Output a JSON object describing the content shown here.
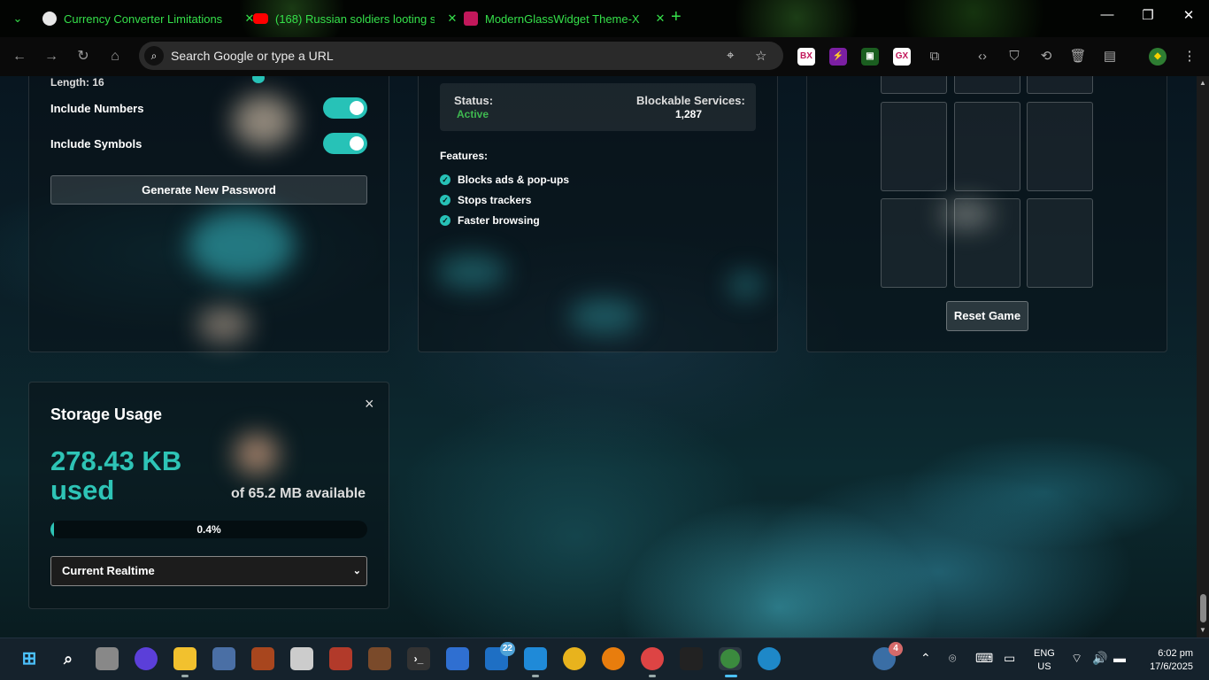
{
  "tabs": [
    {
      "title": "Currency Converter Limitations",
      "favicon": "chatgpt-icon"
    },
    {
      "title": "(168) Russian soldiers looting s",
      "favicon": "youtube-icon"
    },
    {
      "title": "ModernGlassWidget Theme-X",
      "favicon": "operagx-icon"
    }
  ],
  "toolbar": {
    "search_placeholder": "Search Google or type a URL",
    "extensions": [
      "BX",
      "⚡",
      "▣",
      "GX"
    ]
  },
  "password_panel": {
    "length_label": "Length: 16",
    "include_numbers_label": "Include Numbers",
    "include_numbers_on": true,
    "include_symbols_label": "Include Symbols",
    "include_symbols_on": true,
    "generate_button": "Generate New Password"
  },
  "adblock_panel": {
    "status_label": "Status:",
    "status_value": "Active",
    "blockable_label": "Blockable Services:",
    "blockable_value": "1,287",
    "features_title": "Features:",
    "features": [
      "Blocks ads & pop-ups",
      "Stops trackers",
      "Faster browsing"
    ]
  },
  "game_panel": {
    "reset_button": "Reset Game"
  },
  "storage_panel": {
    "title": "Storage Usage",
    "used_value": "278.43 KB",
    "used_suffix": "used",
    "available_text": "of 65.2 MB available",
    "progress_text": "0.4%",
    "progress_fraction": 0.004,
    "select_value": "Current Realtime",
    "close_glyph": "×"
  },
  "taskbar": {
    "mail_badge": "22",
    "weather_badge": "4",
    "lang_top": "ENG",
    "lang_bottom": "US",
    "time": "6:02 pm",
    "date": "17/6/2025"
  },
  "colors": {
    "accent": "#2ec4b6",
    "toggle_on": "#27c2b7",
    "status_active": "#3fb950",
    "tab_text": "#35e04a"
  }
}
